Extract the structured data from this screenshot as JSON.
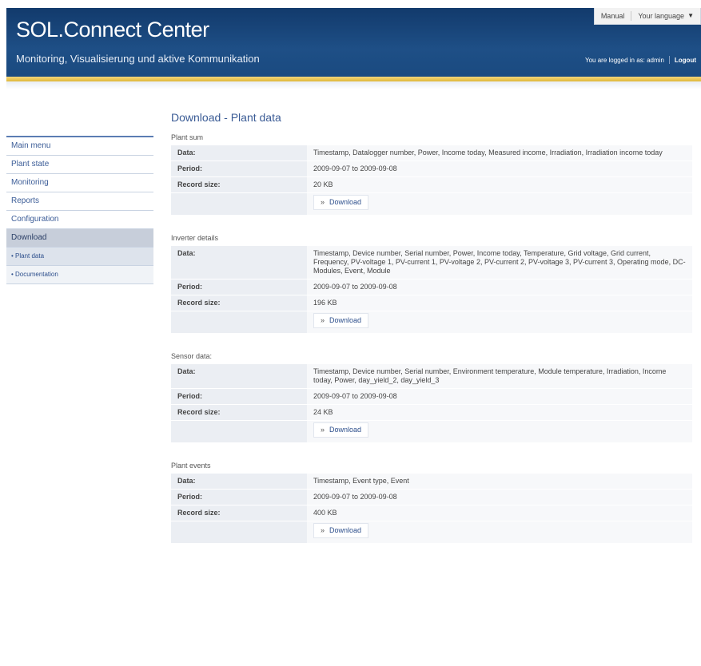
{
  "header": {
    "brand": "SOL.Connect Center",
    "subtitle": "Monitoring, Visualisierung und aktive Kommunikation",
    "manual": "Manual",
    "language": "Your language",
    "logged_in": "You are logged in as: admin",
    "logout": "Logout"
  },
  "sidebar": {
    "items": [
      {
        "label": "Main menu"
      },
      {
        "label": "Plant state"
      },
      {
        "label": "Monitoring"
      },
      {
        "label": "Reports"
      },
      {
        "label": "Configuration"
      },
      {
        "label": "Download"
      }
    ],
    "subitems": [
      {
        "label": "• Plant data"
      },
      {
        "label": "• Documentation"
      }
    ]
  },
  "main": {
    "page_title": "Download - Plant data",
    "labels": {
      "data": "Data:",
      "period": "Period:",
      "record_size": "Record size:",
      "download": "Download"
    },
    "sections": [
      {
        "title": "Plant sum",
        "data": "Timestamp, Datalogger number, Power, Income today, Measured income, Irradiation, Irradiation income today",
        "period": "2009-09-07 to 2009-09-08",
        "size": "20 KB"
      },
      {
        "title": "Inverter details",
        "data": "Timestamp, Device number, Serial number, Power, Income today, Temperature, Grid voltage, Grid current, Frequency, PV-voltage 1, PV-current 1, PV-voltage 2, PV-current 2, PV-voltage 3, PV-current 3, Operating mode, DC-Modules, Event, Module",
        "period": "2009-09-07 to 2009-09-08",
        "size": "196 KB"
      },
      {
        "title": "Sensor data:",
        "data": "Timestamp, Device number, Serial number, Environment temperature, Module temperature, Irradiation, Income today, Power, day_yield_2, day_yield_3",
        "period": "2009-09-07 to 2009-09-08",
        "size": "24 KB"
      },
      {
        "title": "Plant events",
        "data": "Timestamp, Event type, Event",
        "period": "2009-09-07 to 2009-09-08",
        "size": "400 KB"
      }
    ]
  },
  "colors": {
    "header_blue": "#1e4f86",
    "gold_rule": "#e0b83a",
    "link_blue": "#3b5c97"
  }
}
